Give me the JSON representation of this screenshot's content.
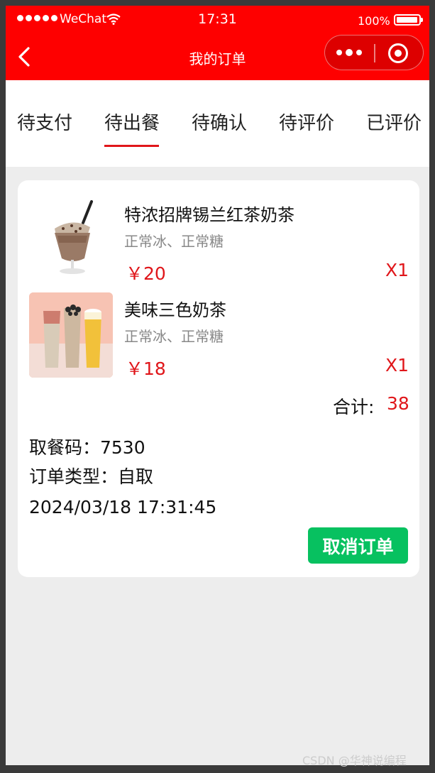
{
  "status_bar": {
    "carrier": "WeChat",
    "time": "17:31",
    "battery": "100%"
  },
  "nav": {
    "title": "我的订单"
  },
  "tabs": [
    {
      "label": "待支付"
    },
    {
      "label": "待出餐",
      "active": true
    },
    {
      "label": "待确认"
    },
    {
      "label": "待评价"
    },
    {
      "label": "已评价"
    }
  ],
  "order": {
    "items": [
      {
        "name": "特浓招牌锡兰红茶奶茶",
        "spec": "正常冰、正常糖",
        "price": "￥20",
        "qty": "X1",
        "image": "milk-tea-glass-image"
      },
      {
        "name": "美味三色奶茶",
        "spec": "正常冰、正常糖",
        "price": "￥18",
        "qty": "X1",
        "image": "three-milk-teas-image"
      }
    ],
    "total_label": "合计:",
    "total_value": "38",
    "pickup_code_line": "取餐码：7530",
    "order_type_line": "订单类型：自取",
    "datetime": "2024/03/18 17:31:45",
    "cancel_label": "取消订单"
  },
  "colors": {
    "brand_red": "#fe0000",
    "price_red": "#e0161a",
    "button_green": "#07c160"
  },
  "watermark": "CSDN @华神说编程"
}
